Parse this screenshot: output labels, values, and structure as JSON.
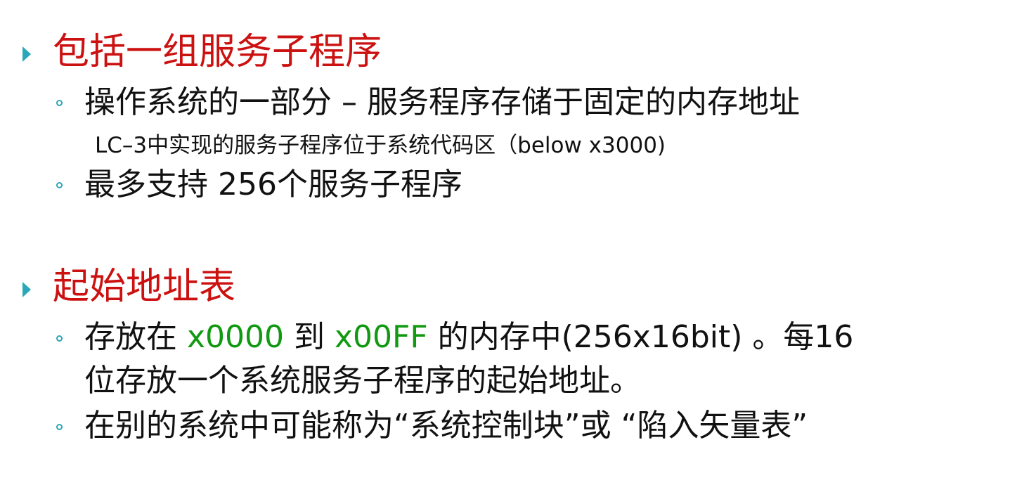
{
  "colors": {
    "heading": "#cc1111",
    "bullet": "#2aa7b8",
    "highlight": "#119911",
    "text": "#111111"
  },
  "section1": {
    "heading": "包括一组服务子程序",
    "item1": "操作系统的一部分 – 服务程序存储于固定的内存地址",
    "note": "LC–3中实现的服务子程序位于系统代码区（below x3000)",
    "item2": "最多支持 256个服务子程序"
  },
  "section2": {
    "heading": "起始地址表",
    "item1": {
      "part1": "存放在 ",
      "addr_start": "x0000",
      "part2": " 到 ",
      "addr_end": "x00FF",
      "part3": " 的内存中(256x16bit) 。每16",
      "line2": "位存放一个系统服务子程序的起始地址。"
    },
    "item2": "在别的系统中可能称为“系统控制块”或 “陷入矢量表”"
  }
}
